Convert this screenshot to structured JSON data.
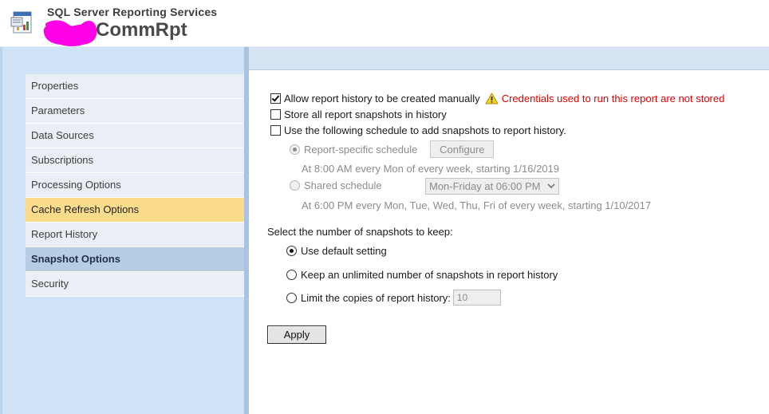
{
  "header": {
    "suite_title": "SQL Server Reporting Services",
    "report_title": "CommRpt",
    "redaction_color": "#ff00e6"
  },
  "sidebar": {
    "items": [
      {
        "label": "Properties",
        "state": "normal"
      },
      {
        "label": "Parameters",
        "state": "normal"
      },
      {
        "label": "Data Sources",
        "state": "normal"
      },
      {
        "label": "Subscriptions",
        "state": "normal"
      },
      {
        "label": "Processing Options",
        "state": "normal"
      },
      {
        "label": "Cache Refresh Options",
        "state": "hover"
      },
      {
        "label": "Report History",
        "state": "normal"
      },
      {
        "label": "Snapshot Options",
        "state": "active"
      },
      {
        "label": "Security",
        "state": "normal"
      }
    ]
  },
  "history": {
    "allow_manual_label": "Allow report history to be created manually",
    "allow_manual_checked": true,
    "warning_icon": "warning-icon",
    "warning_text": "Credentials used to run this report are not stored",
    "store_all_label": "Store all report snapshots in history",
    "store_all_checked": false,
    "use_schedule_label": "Use the following schedule to add snapshots to report history.",
    "use_schedule_checked": false,
    "report_specific_label": "Report-specific schedule",
    "configure_label": "Configure",
    "report_specific_desc": "At 8:00 AM every Mon of every week, starting 1/16/2019",
    "shared_label": "Shared schedule",
    "shared_select_value": "Mon-Friday at 06:00 PM",
    "shared_desc": "At 6:00 PM every Mon, Tue, Wed, Thu, Fri of every week, starting 1/10/2017"
  },
  "snapshots": {
    "heading": "Select the number of snapshots to keep:",
    "default_label": "Use default setting",
    "unlimited_label": "Keep an unlimited number of snapshots in report history",
    "limit_label": "Limit the copies of report history:",
    "limit_value": "10",
    "selected": "default"
  },
  "actions": {
    "apply_label": "Apply"
  },
  "colors": {
    "warning_red": "#e00000",
    "sidebar_bg": "#cfe2f6",
    "hover_bg": "#fbdc8a",
    "active_bg": "#b7cde6"
  }
}
